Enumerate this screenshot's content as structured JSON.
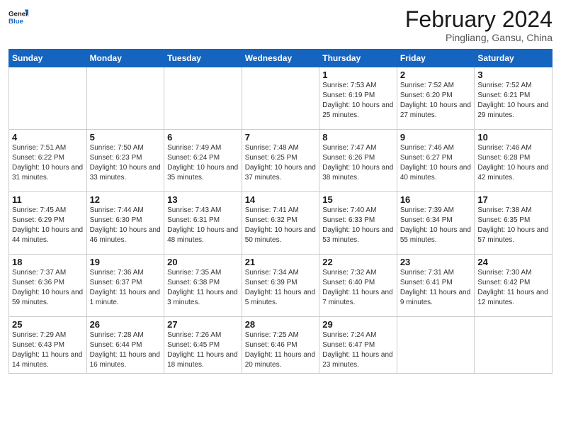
{
  "logo": {
    "line1": "General",
    "line2": "Blue"
  },
  "title": "February 2024",
  "location": "Pingliang, Gansu, China",
  "days_of_week": [
    "Sunday",
    "Monday",
    "Tuesday",
    "Wednesday",
    "Thursday",
    "Friday",
    "Saturday"
  ],
  "weeks": [
    [
      {
        "num": "",
        "info": ""
      },
      {
        "num": "",
        "info": ""
      },
      {
        "num": "",
        "info": ""
      },
      {
        "num": "",
        "info": ""
      },
      {
        "num": "1",
        "info": "Sunrise: 7:53 AM\nSunset: 6:19 PM\nDaylight: 10 hours and 25 minutes."
      },
      {
        "num": "2",
        "info": "Sunrise: 7:52 AM\nSunset: 6:20 PM\nDaylight: 10 hours and 27 minutes."
      },
      {
        "num": "3",
        "info": "Sunrise: 7:52 AM\nSunset: 6:21 PM\nDaylight: 10 hours and 29 minutes."
      }
    ],
    [
      {
        "num": "4",
        "info": "Sunrise: 7:51 AM\nSunset: 6:22 PM\nDaylight: 10 hours and 31 minutes."
      },
      {
        "num": "5",
        "info": "Sunrise: 7:50 AM\nSunset: 6:23 PM\nDaylight: 10 hours and 33 minutes."
      },
      {
        "num": "6",
        "info": "Sunrise: 7:49 AM\nSunset: 6:24 PM\nDaylight: 10 hours and 35 minutes."
      },
      {
        "num": "7",
        "info": "Sunrise: 7:48 AM\nSunset: 6:25 PM\nDaylight: 10 hours and 37 minutes."
      },
      {
        "num": "8",
        "info": "Sunrise: 7:47 AM\nSunset: 6:26 PM\nDaylight: 10 hours and 38 minutes."
      },
      {
        "num": "9",
        "info": "Sunrise: 7:46 AM\nSunset: 6:27 PM\nDaylight: 10 hours and 40 minutes."
      },
      {
        "num": "10",
        "info": "Sunrise: 7:46 AM\nSunset: 6:28 PM\nDaylight: 10 hours and 42 minutes."
      }
    ],
    [
      {
        "num": "11",
        "info": "Sunrise: 7:45 AM\nSunset: 6:29 PM\nDaylight: 10 hours and 44 minutes."
      },
      {
        "num": "12",
        "info": "Sunrise: 7:44 AM\nSunset: 6:30 PM\nDaylight: 10 hours and 46 minutes."
      },
      {
        "num": "13",
        "info": "Sunrise: 7:43 AM\nSunset: 6:31 PM\nDaylight: 10 hours and 48 minutes."
      },
      {
        "num": "14",
        "info": "Sunrise: 7:41 AM\nSunset: 6:32 PM\nDaylight: 10 hours and 50 minutes."
      },
      {
        "num": "15",
        "info": "Sunrise: 7:40 AM\nSunset: 6:33 PM\nDaylight: 10 hours and 53 minutes."
      },
      {
        "num": "16",
        "info": "Sunrise: 7:39 AM\nSunset: 6:34 PM\nDaylight: 10 hours and 55 minutes."
      },
      {
        "num": "17",
        "info": "Sunrise: 7:38 AM\nSunset: 6:35 PM\nDaylight: 10 hours and 57 minutes."
      }
    ],
    [
      {
        "num": "18",
        "info": "Sunrise: 7:37 AM\nSunset: 6:36 PM\nDaylight: 10 hours and 59 minutes."
      },
      {
        "num": "19",
        "info": "Sunrise: 7:36 AM\nSunset: 6:37 PM\nDaylight: 11 hours and 1 minute."
      },
      {
        "num": "20",
        "info": "Sunrise: 7:35 AM\nSunset: 6:38 PM\nDaylight: 11 hours and 3 minutes."
      },
      {
        "num": "21",
        "info": "Sunrise: 7:34 AM\nSunset: 6:39 PM\nDaylight: 11 hours and 5 minutes."
      },
      {
        "num": "22",
        "info": "Sunrise: 7:32 AM\nSunset: 6:40 PM\nDaylight: 11 hours and 7 minutes."
      },
      {
        "num": "23",
        "info": "Sunrise: 7:31 AM\nSunset: 6:41 PM\nDaylight: 11 hours and 9 minutes."
      },
      {
        "num": "24",
        "info": "Sunrise: 7:30 AM\nSunset: 6:42 PM\nDaylight: 11 hours and 12 minutes."
      }
    ],
    [
      {
        "num": "25",
        "info": "Sunrise: 7:29 AM\nSunset: 6:43 PM\nDaylight: 11 hours and 14 minutes."
      },
      {
        "num": "26",
        "info": "Sunrise: 7:28 AM\nSunset: 6:44 PM\nDaylight: 11 hours and 16 minutes."
      },
      {
        "num": "27",
        "info": "Sunrise: 7:26 AM\nSunset: 6:45 PM\nDaylight: 11 hours and 18 minutes."
      },
      {
        "num": "28",
        "info": "Sunrise: 7:25 AM\nSunset: 6:46 PM\nDaylight: 11 hours and 20 minutes."
      },
      {
        "num": "29",
        "info": "Sunrise: 7:24 AM\nSunset: 6:47 PM\nDaylight: 11 hours and 23 minutes."
      },
      {
        "num": "",
        "info": ""
      },
      {
        "num": "",
        "info": ""
      }
    ]
  ]
}
